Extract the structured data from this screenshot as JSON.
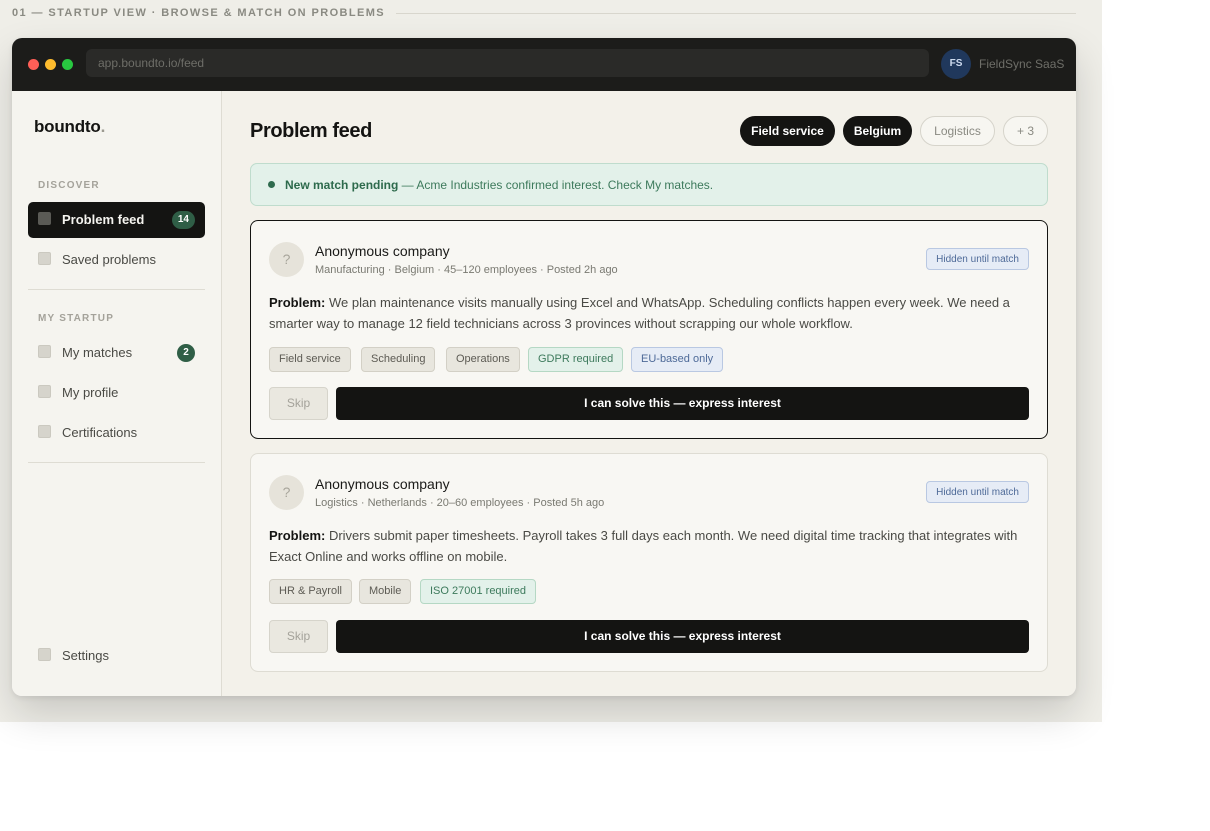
{
  "section": {
    "label": "01 — STARTUP VIEW · BROWSE & MATCH ON PROBLEMS"
  },
  "browser": {
    "url": "app.boundto.io/feed",
    "user_initials": "FS",
    "user_name": "FieldSync SaaS"
  },
  "sidebar": {
    "logo": "boundto",
    "logo_dot": ".",
    "discover_label": "DISCOVER",
    "items_discover": [
      {
        "label": "Problem feed",
        "badge": "14",
        "active": true
      },
      {
        "label": "Saved problems"
      }
    ],
    "my_startup_label": "MY STARTUP",
    "items_startup": [
      {
        "label": "My matches",
        "badge": "2"
      },
      {
        "label": "My profile"
      },
      {
        "label": "Certifications"
      }
    ],
    "settings_label": "Settings"
  },
  "main": {
    "title": "Problem feed",
    "filters": [
      {
        "label": "Field service",
        "active": true
      },
      {
        "label": "Belgium",
        "active": true
      },
      {
        "label": "Logistics",
        "active": false
      },
      {
        "label": "+ 3",
        "active": false
      }
    ],
    "notice": {
      "bold": "New match pending",
      "text": " — Acme Industries confirmed interest. Check My matches."
    },
    "cards": [
      {
        "avatar": "?",
        "company": "Anonymous company",
        "meta": "Manufacturing · Belgium · 45–120 employees · Posted 2h ago",
        "hidden_badge": "Hidden until match",
        "problem_label": "Problem:",
        "problem_text": " We plan maintenance visits manually using Excel and WhatsApp. Scheduling conflicts happen every week. We need a smarter way to manage 12 field technicians across 3 provinces without scrapping our whole workflow.",
        "tags": [
          {
            "label": "Field service",
            "style": "neutral"
          },
          {
            "label": "Scheduling",
            "style": "neutral"
          },
          {
            "label": "Operations",
            "style": "neutral"
          },
          {
            "label": "GDPR required",
            "style": "green"
          },
          {
            "label": "EU-based only",
            "style": "blue"
          }
        ],
        "skip_label": "Skip",
        "interest_label": "I can solve this — express interest"
      },
      {
        "avatar": "?",
        "company": "Anonymous company",
        "meta": "Logistics · Netherlands · 20–60 employees · Posted 5h ago",
        "hidden_badge": "Hidden until match",
        "problem_label": "Problem:",
        "problem_text": " Drivers submit paper timesheets. Payroll takes 3 full days each month. We need digital time tracking that integrates with Exact Online and works offline on mobile.",
        "tags": [
          {
            "label": "HR & Payroll",
            "style": "neutral"
          },
          {
            "label": "Mobile",
            "style": "neutral"
          },
          {
            "label": "ISO 27001 required",
            "style": "green"
          }
        ],
        "skip_label": "Skip",
        "interest_label": "I can solve this — express interest"
      }
    ]
  }
}
